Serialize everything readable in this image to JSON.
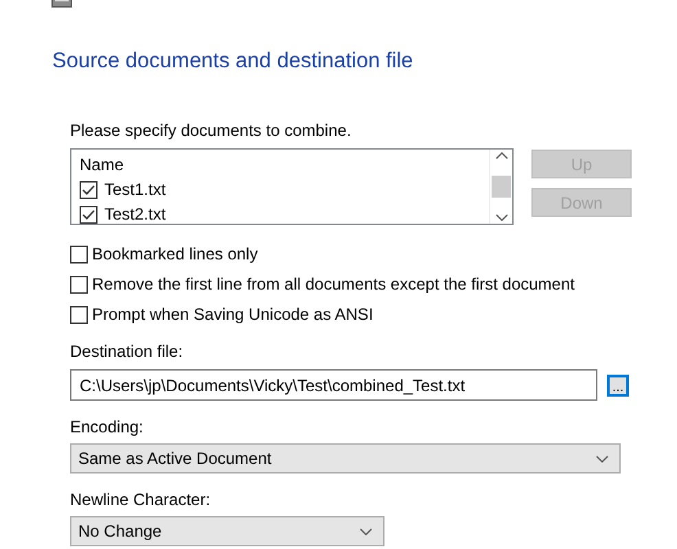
{
  "heading": "Source documents and destination file",
  "documents": {
    "label": "Please specify documents to combine.",
    "column": "Name",
    "items": [
      {
        "name": "Test1.txt",
        "checked": true
      },
      {
        "name": "Test2.txt",
        "checked": true
      }
    ]
  },
  "buttons": [
    {
      "label": "Up",
      "disabled": true
    },
    {
      "label": "Down",
      "disabled": true
    }
  ],
  "options": [
    {
      "label": "Bookmarked lines only",
      "checked": false
    },
    {
      "label": "Remove the first line from all documents except the first document",
      "checked": false
    },
    {
      "label": "Prompt when Saving Unicode as ANSI",
      "checked": false
    }
  ],
  "destination": {
    "label": "Destination file:",
    "value": "C:\\Users\\jp\\Documents\\Vicky\\Test\\combined_Test.txt",
    "browse": "..."
  },
  "encoding": {
    "label": "Encoding:",
    "value": "Same as Active Document"
  },
  "newline": {
    "label": "Newline Character:",
    "value": "No Change"
  }
}
